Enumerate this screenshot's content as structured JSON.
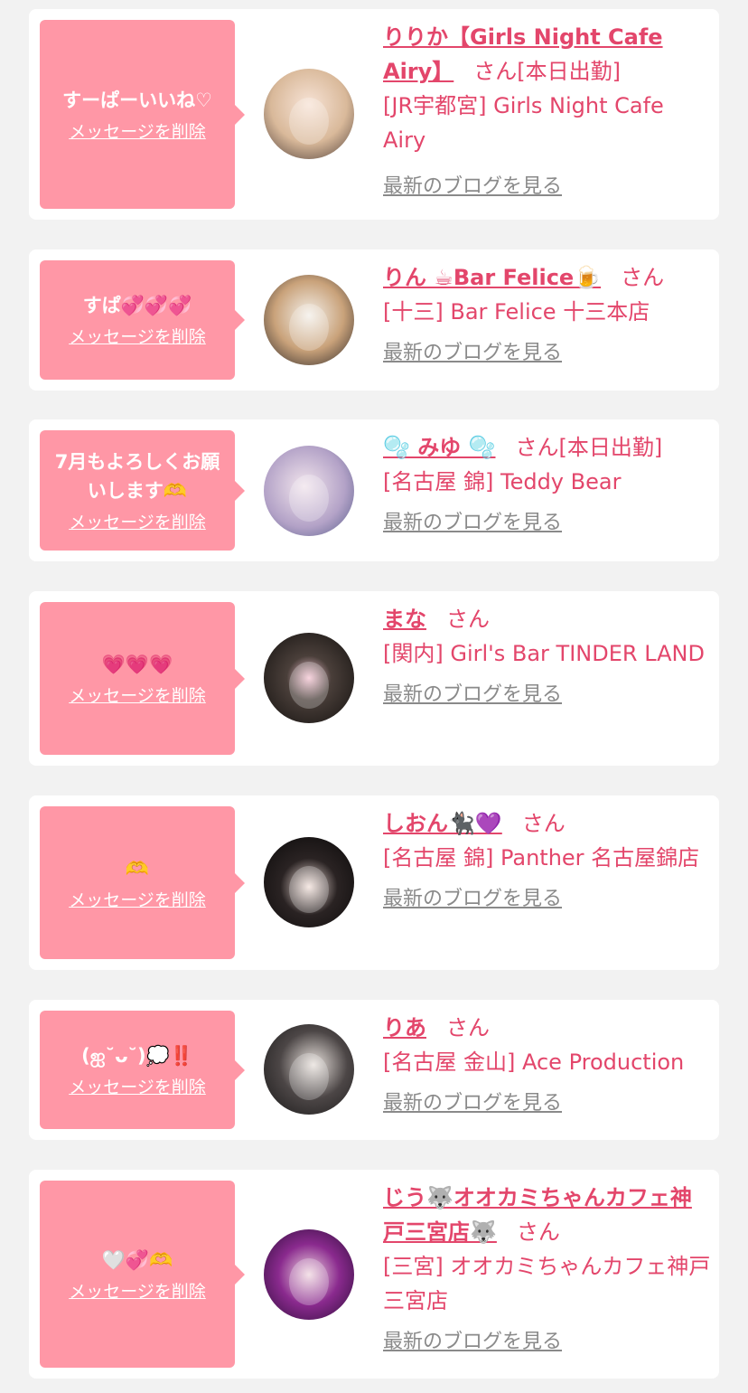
{
  "cards": [
    {
      "message": "すーぱーいいね♡",
      "delete_label": "メッセージを削除",
      "name": "りりか【Girls Night Cafe Airy】",
      "honorific": "さん",
      "status": "[本日出勤]",
      "shop": "[JR宇都宮] Girls Night Cafe Airy",
      "blog_label": "最新のブログを見る",
      "avatar_icon": "girl-photo-blonde"
    },
    {
      "message": "すぱ💞💞💞",
      "delete_label": "メッセージを削除",
      "name": "りん ☕Bar Felice🍺",
      "honorific": "さん",
      "status": "",
      "shop": "[十三] Bar Felice 十三本店",
      "blog_label": "最新のブログを見る",
      "avatar_icon": "girl-photo-dog"
    },
    {
      "message": "7月もよろしくお願いします🫶",
      "delete_label": "メッセージを削除",
      "name": "🫧 みゆ 🫧",
      "honorific": "さん",
      "status": "[本日出勤]",
      "shop": "[名古屋 錦] Teddy Bear",
      "blog_label": "最新のブログを見る",
      "avatar_icon": "girl-photo-plaid"
    },
    {
      "message": "💗💗💗",
      "delete_label": "メッセージを削除",
      "name": "まな",
      "honorific": "さん",
      "status": "",
      "shop": "[関内] Girl's Bar TINDER LAND",
      "blog_label": "最新のブログを見る",
      "avatar_icon": "plush-photo"
    },
    {
      "message": "🫶",
      "delete_label": "メッセージを削除",
      "name": "しおん🐈‍⬛💜",
      "honorific": "さん",
      "status": "",
      "shop": "[名古屋 錦] Panther 名古屋錦店",
      "blog_label": "最新のブログを見る",
      "avatar_icon": "girl-photo-black-hair"
    },
    {
      "message": "(ஐ˘ᴗ˘)💭‼️",
      "delete_label": "メッセージを削除",
      "name": "りあ",
      "honorific": "さん",
      "status": "",
      "shop": "[名古屋 金山] Ace Production",
      "blog_label": "最新のブログを見る",
      "avatar_icon": "girl-photo-mirror"
    },
    {
      "message": "🤍💞🫶",
      "delete_label": "メッセージを削除",
      "name": "じう🐺オオカミちゃんカフェ神戸三宮店🐺",
      "honorific": "さん",
      "status": "",
      "shop": "[三宮] オオカミちゃんカフェ神戸三宮店",
      "blog_label": "最新のブログを見る",
      "avatar_icon": "girl-photo-neon"
    }
  ],
  "colors": {
    "bubble": "#ff97a6",
    "accent": "#e3466b",
    "link_gray": "#8a8a8a",
    "background": "#f2f2f2"
  }
}
